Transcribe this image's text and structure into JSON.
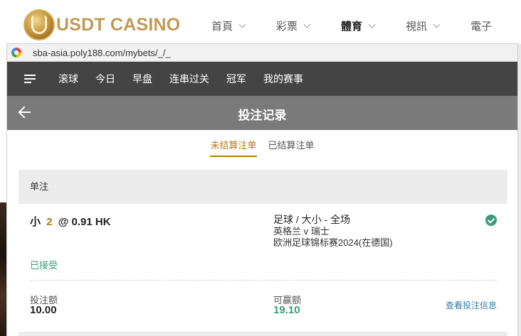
{
  "site": {
    "logo_text": "USDT CASINO",
    "nav": [
      "首頁",
      "彩票",
      "體育",
      "視訊",
      "電子"
    ],
    "active_nav": "體育"
  },
  "browser": {
    "url": "sba-asia.poly188.com/mybets/_/_"
  },
  "app_nav": {
    "items": [
      "滚球",
      "今日",
      "早盘",
      "连串过关",
      "冠军",
      "我的赛事"
    ]
  },
  "title_bar": {
    "title": "投注记录"
  },
  "tabs": {
    "unsettled": "未结算注单",
    "settled": "已结算注单",
    "active": "unsettled"
  },
  "section": {
    "heading": "单注"
  },
  "bet": {
    "pick": "小",
    "line": "2",
    "at": "@",
    "odds": "0.91 HK",
    "market": "足球 / 大小 - 全场",
    "match": "英格兰 v 瑞士",
    "league": "欧洲足球锦标赛2024(在德国)",
    "status": "已接受",
    "stake_label": "投注额",
    "stake": "10.00",
    "win_label": "可赢额",
    "win": "19.10",
    "detail_link": "查看投注信息"
  },
  "colors": {
    "accent": "#b27a1e",
    "success": "#3a9b78",
    "nav_bg": "#444444",
    "title_bg": "#7a7a7a",
    "link": "#2f7fa7"
  }
}
